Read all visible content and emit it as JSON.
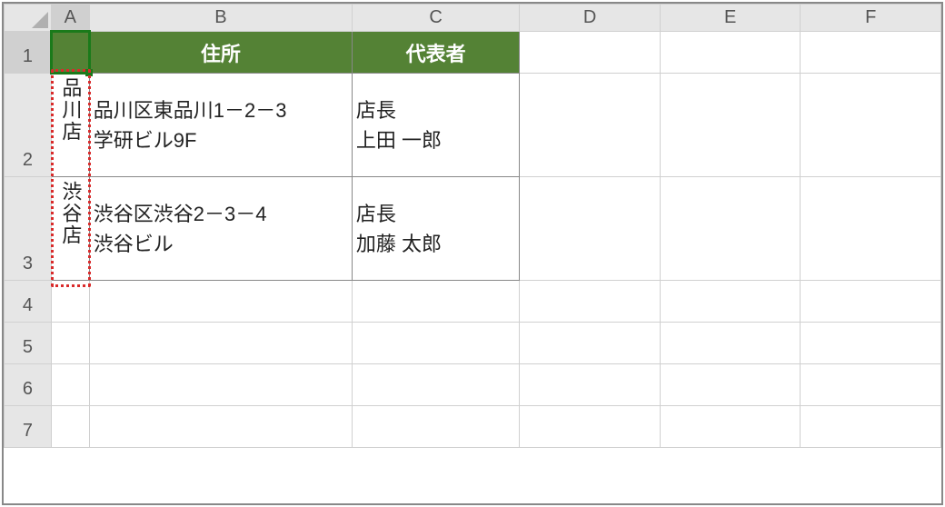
{
  "columns": [
    "A",
    "B",
    "C",
    "D",
    "E",
    "F"
  ],
  "rows": [
    "1",
    "2",
    "3",
    "4",
    "5",
    "6",
    "7"
  ],
  "headers": {
    "B1": "住所",
    "C1": "代表者"
  },
  "cells": {
    "A2": "品川店",
    "B2": "品川区東品川1－2－3\n学研ビル9F",
    "C2": "店長\n上田 一郎",
    "A3": "渋谷店",
    "B3": "渋谷区渋谷2－3－4\n渋谷ビル",
    "C3": "店長\n加藤 太郎"
  }
}
